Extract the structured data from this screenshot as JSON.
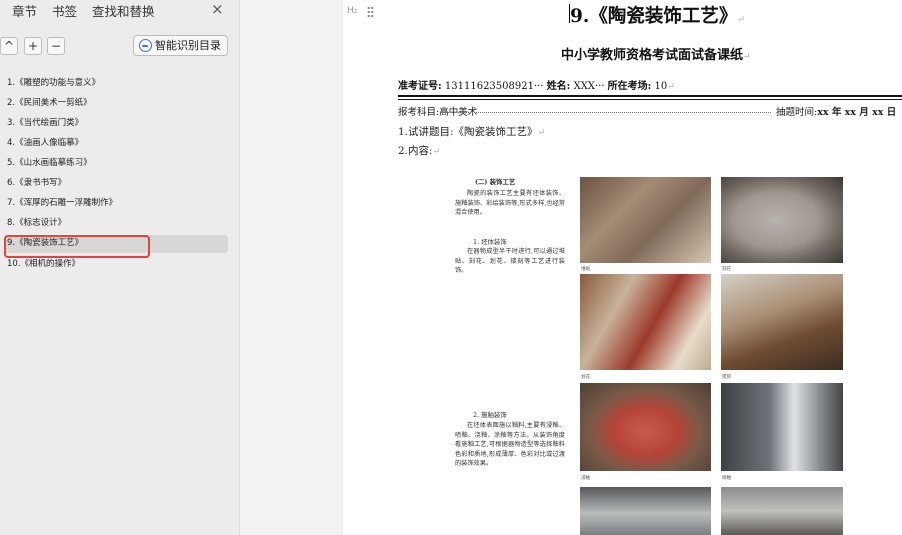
{
  "sidebar": {
    "tabs": [
      "章节",
      "书签",
      "查找和替换"
    ],
    "close_glyph": "×",
    "controls": {
      "collapse_glyph": "^",
      "add_glyph": "+",
      "remove_glyph": "−"
    },
    "smart_button_label": "智能识别目录",
    "toc": [
      "1.《雕塑的功能与意义》",
      "2.《民间美术一剪纸》",
      "3.《当代绘画门类》",
      "4.《油画人像临摹》",
      "5.《山水画临摹练习》",
      "6.《隶书书写》",
      "7.《浑厚的石雕一浮雕制作》",
      "8.《标志设计》",
      "9.《陶瓷装饰工艺》",
      "10.《相机的操作》"
    ],
    "selected_index": 8,
    "highlight_color": "#e0463a"
  },
  "document": {
    "heading_marker": "H₂",
    "title": "9.《陶瓷装饰工艺》",
    "subtitle": "中小学教师资格考试面试备课纸",
    "para_mark": "↵",
    "exam_no_label": "准考证号:",
    "exam_no_value": "13111623508921",
    "name_label": "姓名:",
    "name_value": "XXX",
    "room_label": "所在考场:",
    "room_value": "10",
    "subject_label": "报考科目:",
    "subject_value": "高中美术",
    "draw_time_label": "抽题时间:",
    "draw_time_value": "xx 年 xx 月 xx 日",
    "item1": "1.试讲题目:《陶瓷装饰工艺》",
    "item2": "2.内容:",
    "scan": {
      "section_heading": "(二) 装饰工艺",
      "intro": "陶瓷的装饰工艺主要有坯体装饰、施釉装饰、彩绘装饰等,形式多样,也经常混合使用。",
      "sub1_heading": "1. 坯体装饰",
      "sub1_text": "在器物成型半干时进行,可以通过堆贴、刻花、划花、镂刻等工艺进行装饰。",
      "sub2_heading": "2. 施釉装饰",
      "sub2_text": "在坯体表面施以釉料,主要有浸釉、喷釉、浇釉、涂釉等方法。从装饰角度看施釉工艺,可根据器物造型等选择釉料色彩和质地,形成薄厚、色彩对比或过渡的装饰效果。",
      "captions": [
        "堆贴",
        "刻花",
        "划花",
        "镂刻",
        "浸釉",
        "喷釉"
      ]
    }
  }
}
